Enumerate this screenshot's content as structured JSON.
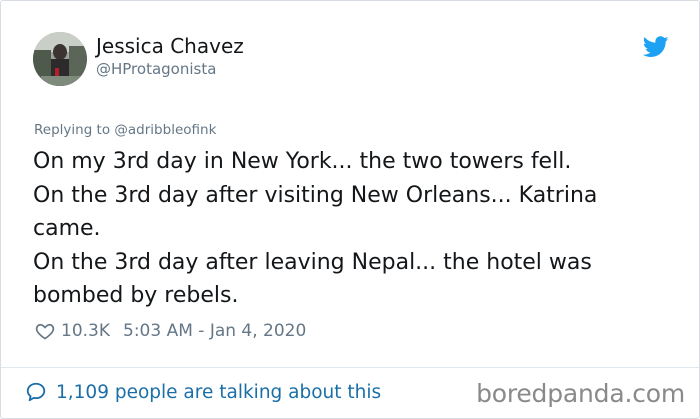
{
  "author": {
    "name": "Jessica Chavez",
    "handle": "@HProtagonista",
    "avatar_icon": "profile-photo"
  },
  "reply": {
    "prefix": "Replying to",
    "to_handle": "@adribbleofink"
  },
  "tweet": {
    "lines": [
      "On my 3rd day in New York... the two towers fell.",
      "On the 3rd day after visiting New Orleans... Katrina",
      "came.",
      "On the 3rd day after leaving Nepal... the hotel was",
      "bombed by rebels."
    ]
  },
  "meta": {
    "likes": "10.3K",
    "time": "5:03 AM - Jan 4, 2020",
    "heart_icon": "heart-outline-icon"
  },
  "footer": {
    "talking": "1,109 people are talking about this",
    "watermark": "boredpanda.com"
  },
  "colors": {
    "twitter_blue": "#1da1f2",
    "link_blue": "#1b6fa8",
    "muted_gray": "#657786",
    "text": "#14171a"
  }
}
